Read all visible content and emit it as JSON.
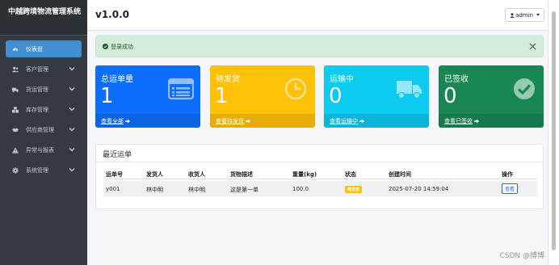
{
  "sidebar": {
    "brand": "中越跨境物流管理系统",
    "items": [
      {
        "label": "仪表盘",
        "icon": "dashboard-icon",
        "active": true
      },
      {
        "label": "客户管理",
        "icon": "users-icon"
      },
      {
        "label": "货运管理",
        "icon": "truck-icon"
      },
      {
        "label": "库存管理",
        "icon": "boxes-icon"
      },
      {
        "label": "供应商管理",
        "icon": "handshake-icon"
      },
      {
        "label": "异常与报表",
        "icon": "warning-icon"
      },
      {
        "label": "系统管理",
        "icon": "gear-icon"
      }
    ]
  },
  "header": {
    "version": "v1.0.0",
    "user": "admin"
  },
  "alert": {
    "message": "登录成功"
  },
  "stats": [
    {
      "title": "总运单量",
      "value": "1",
      "link": "查看全部",
      "color": "#0d6efd",
      "icon": "list-icon"
    },
    {
      "title": "待发货",
      "value": "1",
      "link": "查看待发货",
      "color": "#ffc107",
      "icon": "clock-icon"
    },
    {
      "title": "运输中",
      "value": "0",
      "link": "查看运输中",
      "color": "#0dcaf0",
      "icon": "truck-icon"
    },
    {
      "title": "已签收",
      "value": "0",
      "link": "查看已签收",
      "color": "#198754",
      "icon": "check-circle-icon"
    }
  ],
  "recent": {
    "title": "最近运单",
    "columns": [
      "运单号",
      "发货人",
      "收货人",
      "货物描述",
      "重量(kg)",
      "状态",
      "创建时间",
      "操作"
    ],
    "rows": [
      {
        "id": "y001",
        "sender": "林中明",
        "receiver": "林中明",
        "desc": "这是第一单",
        "weight": "100.0",
        "status": "待发货",
        "created": "2025-07-20 14:59:04",
        "action": "查看"
      }
    ]
  },
  "watermark": "CSDN @搏博"
}
